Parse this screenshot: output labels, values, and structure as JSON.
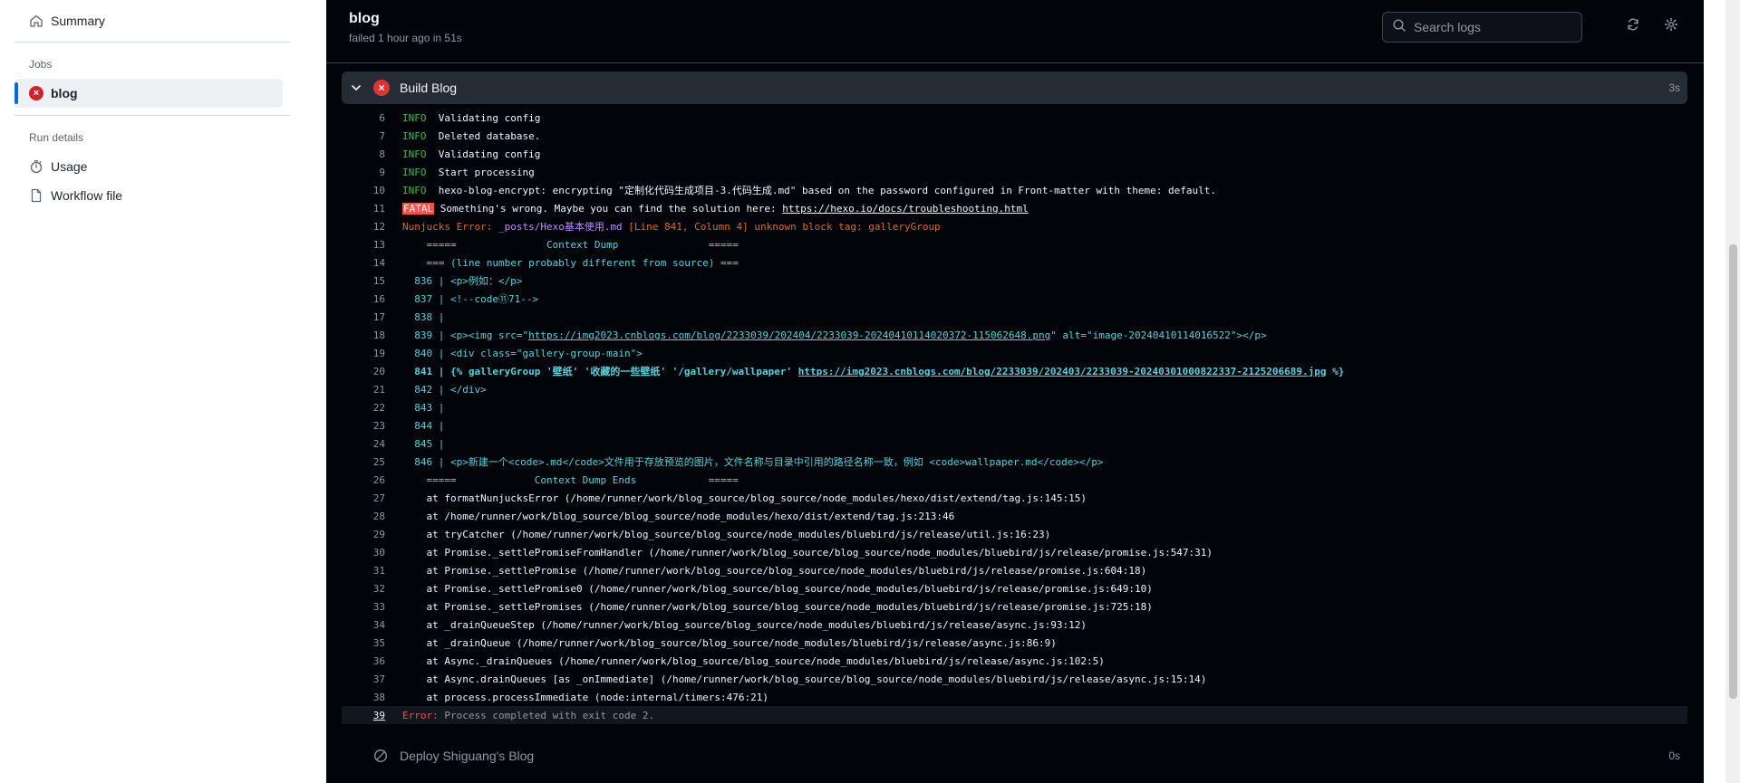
{
  "sidebar": {
    "summary_label": "Summary",
    "jobs_heading": "Jobs",
    "job_label": "blog",
    "run_details_heading": "Run details",
    "usage_label": "Usage",
    "workflow_file_label": "Workflow file"
  },
  "header": {
    "title": "blog",
    "subtitle": "failed 1 hour ago in 51s",
    "search_placeholder": "Search logs"
  },
  "steps": {
    "build": {
      "name": "Build Blog",
      "duration": "3s",
      "status": "failed"
    },
    "deploy": {
      "name": "Deploy Shiguang's Blog",
      "duration": "0s",
      "status": "skipped"
    }
  },
  "log": {
    "lines": [
      {
        "n": "6",
        "segs": [
          {
            "c": "info",
            "t": "INFO"
          },
          {
            "c": "",
            "t": "  Validating config"
          }
        ]
      },
      {
        "n": "7",
        "segs": [
          {
            "c": "info",
            "t": "INFO"
          },
          {
            "c": "",
            "t": "  Deleted database."
          }
        ]
      },
      {
        "n": "8",
        "segs": [
          {
            "c": "info",
            "t": "INFO"
          },
          {
            "c": "",
            "t": "  Validating config"
          }
        ]
      },
      {
        "n": "9",
        "segs": [
          {
            "c": "info",
            "t": "INFO"
          },
          {
            "c": "",
            "t": "  Start processing"
          }
        ]
      },
      {
        "n": "10",
        "segs": [
          {
            "c": "info",
            "t": "INFO"
          },
          {
            "c": "",
            "t": "  hexo-blog-encrypt: encrypting \"定制化代码生成项目-3.代码生成.md\" based on the password configured in Front-matter with theme: default."
          }
        ]
      },
      {
        "n": "11",
        "segs": [
          {
            "c": "fatal",
            "t": "FATAL"
          },
          {
            "c": "",
            "t": " Something's wrong. Maybe you can find the solution here: "
          },
          {
            "c": "link",
            "t": "https://hexo.io/docs/troubleshooting.html"
          }
        ]
      },
      {
        "n": "12",
        "segs": [
          {
            "c": "orange",
            "t": "Nunjucks Error: "
          },
          {
            "c": "magenta",
            "t": "_posts/Hexo基本使用.md"
          },
          {
            "c": "orange",
            "t": " [Line 841, Column 4] unknown block tag: galleryGroup"
          }
        ]
      },
      {
        "n": "13",
        "segs": [
          {
            "c": "cyan",
            "t": "    =====               Context Dump               ====="
          }
        ]
      },
      {
        "n": "14",
        "segs": [
          {
            "c": "cyan",
            "t": "    === (line number probably different from source) ==="
          }
        ]
      },
      {
        "n": "15",
        "segs": [
          {
            "c": "cyan",
            "t": "  836 | <p>例如：</p>"
          }
        ]
      },
      {
        "n": "16",
        "segs": [
          {
            "c": "cyan",
            "t": "  837 | <!--code⑪71-->"
          }
        ]
      },
      {
        "n": "17",
        "segs": [
          {
            "c": "cyan",
            "t": "  838 |"
          }
        ]
      },
      {
        "n": "18",
        "segs": [
          {
            "c": "cyan",
            "t": "  839 | <p><img src=\""
          },
          {
            "c": "cyan link",
            "t": "https://img2023.cnblogs.com/blog/2233039/202404/2233039-20240410114020372-115062648.png"
          },
          {
            "c": "cyan",
            "t": "\" alt=\"image-20240410114016522\"></p>"
          }
        ]
      },
      {
        "n": "19",
        "segs": [
          {
            "c": "cyan",
            "t": "  840 | <div class=\"gallery-group-main\">"
          }
        ]
      },
      {
        "n": "20",
        "segs": [
          {
            "c": "cyanb",
            "t": "  841 | {% galleryGroup '壁纸' '收藏的一些壁纸' '/gallery/wallpaper' "
          },
          {
            "c": "cyanb link",
            "t": "https://img2023.cnblogs.com/blog/2233039/202403/2233039-20240301000822337-2125206689.jpg"
          },
          {
            "c": "cyanb",
            "t": " %}"
          }
        ]
      },
      {
        "n": "21",
        "segs": [
          {
            "c": "cyan",
            "t": "  842 | </div>"
          }
        ]
      },
      {
        "n": "22",
        "segs": [
          {
            "c": "cyan",
            "t": "  843 |"
          }
        ]
      },
      {
        "n": "23",
        "segs": [
          {
            "c": "cyan",
            "t": "  844 |"
          }
        ]
      },
      {
        "n": "24",
        "segs": [
          {
            "c": "cyan",
            "t": "  845 |"
          }
        ]
      },
      {
        "n": "25",
        "segs": [
          {
            "c": "cyan",
            "t": "  846 | <p>新建一个<code>.md</code>文件用于存放预览的图片，文件名称与目录中引用的路径名称一致，例如 <code>wallpaper.md</code></p>"
          }
        ]
      },
      {
        "n": "26",
        "segs": [
          {
            "c": "cyan",
            "t": "    =====             Context Dump Ends            ====="
          }
        ]
      },
      {
        "n": "27",
        "segs": [
          {
            "c": "",
            "t": "    at formatNunjucksError (/home/runner/work/blog_source/blog_source/node_modules/hexo/dist/extend/tag.js:145:15)"
          }
        ]
      },
      {
        "n": "28",
        "segs": [
          {
            "c": "",
            "t": "    at /home/runner/work/blog_source/blog_source/node_modules/hexo/dist/extend/tag.js:213:46"
          }
        ]
      },
      {
        "n": "29",
        "segs": [
          {
            "c": "",
            "t": "    at tryCatcher (/home/runner/work/blog_source/blog_source/node_modules/bluebird/js/release/util.js:16:23)"
          }
        ]
      },
      {
        "n": "30",
        "segs": [
          {
            "c": "",
            "t": "    at Promise._settlePromiseFromHandler (/home/runner/work/blog_source/blog_source/node_modules/bluebird/js/release/promise.js:547:31)"
          }
        ]
      },
      {
        "n": "31",
        "segs": [
          {
            "c": "",
            "t": "    at Promise._settlePromise (/home/runner/work/blog_source/blog_source/node_modules/bluebird/js/release/promise.js:604:18)"
          }
        ]
      },
      {
        "n": "32",
        "segs": [
          {
            "c": "",
            "t": "    at Promise._settlePromise0 (/home/runner/work/blog_source/blog_source/node_modules/bluebird/js/release/promise.js:649:10)"
          }
        ]
      },
      {
        "n": "33",
        "segs": [
          {
            "c": "",
            "t": "    at Promise._settlePromises (/home/runner/work/blog_source/blog_source/node_modules/bluebird/js/release/promise.js:725:18)"
          }
        ]
      },
      {
        "n": "34",
        "segs": [
          {
            "c": "",
            "t": "    at _drainQueueStep (/home/runner/work/blog_source/blog_source/node_modules/bluebird/js/release/async.js:93:12)"
          }
        ]
      },
      {
        "n": "35",
        "segs": [
          {
            "c": "",
            "t": "    at _drainQueue (/home/runner/work/blog_source/blog_source/node_modules/bluebird/js/release/async.js:86:9)"
          }
        ]
      },
      {
        "n": "36",
        "segs": [
          {
            "c": "",
            "t": "    at Async._drainQueues (/home/runner/work/blog_source/blog_source/node_modules/bluebird/js/release/async.js:102:5)"
          }
        ]
      },
      {
        "n": "37",
        "segs": [
          {
            "c": "",
            "t": "    at Async.drainQueues [as _onImmediate] (/home/runner/work/blog_source/blog_source/node_modules/bluebird/js/release/async.js:15:14)"
          }
        ]
      },
      {
        "n": "38",
        "segs": [
          {
            "c": "",
            "t": "    at process.processImmediate (node:internal/timers:476:21)"
          }
        ]
      },
      {
        "n": "39",
        "segs": [
          {
            "c": "err",
            "t": "Error:"
          },
          {
            "c": "mute",
            "t": " Process completed with exit code 2."
          }
        ],
        "highlight": true
      }
    ]
  },
  "colors": {
    "panel_bg": "#010409",
    "step_bg": "#262c36",
    "fail_red": "#da3633",
    "info_green": "#3fb950",
    "context_cyan": "#56d4dd",
    "nunjucks_orange": "#db6d28",
    "active_accent": "#0969da"
  },
  "icons": {
    "summary": "home-icon",
    "job_status": "x-circle-icon",
    "usage": "stopwatch-icon",
    "workflow_file": "file-icon",
    "search": "search-icon",
    "refresh": "sync-icon",
    "settings": "gear-icon",
    "step_toggle": "chevron-down-icon",
    "skipped": "skip-icon"
  }
}
